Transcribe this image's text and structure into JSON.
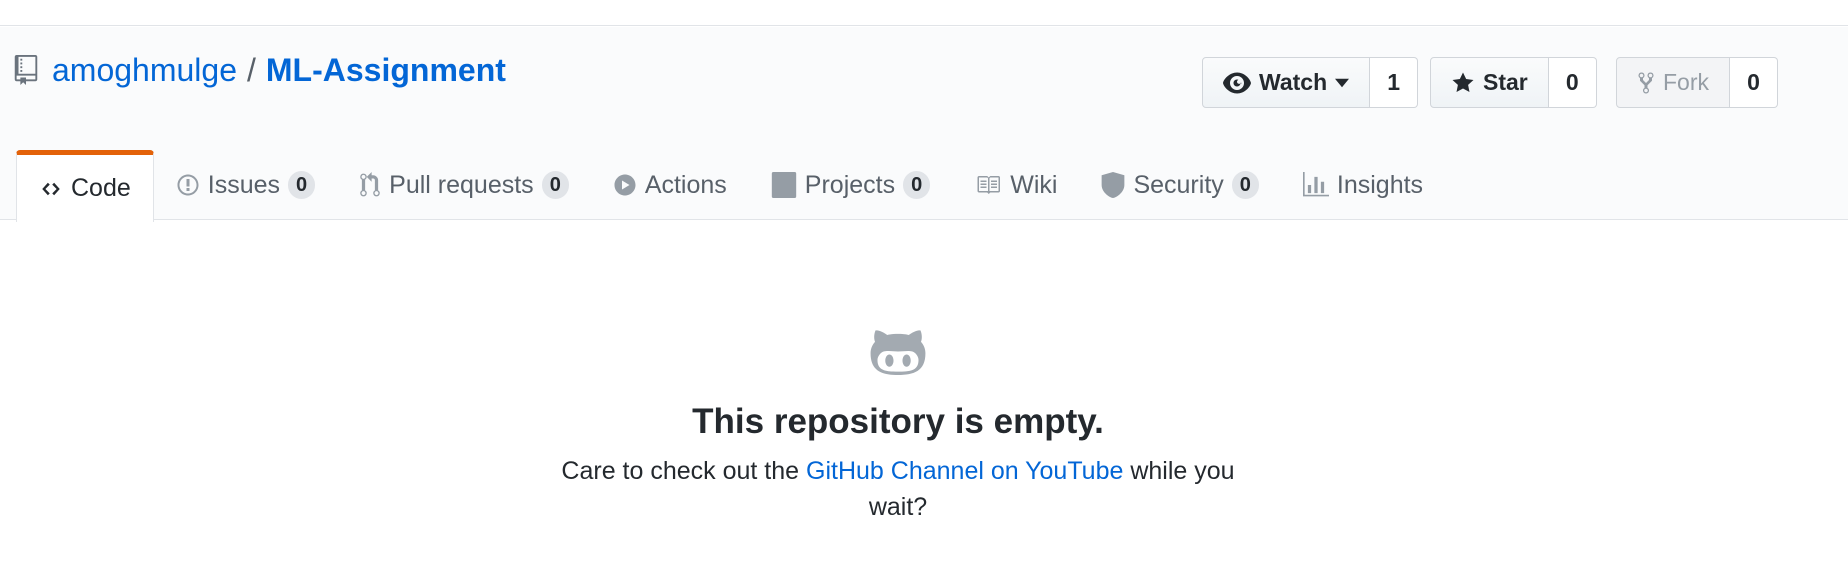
{
  "repo": {
    "owner": "amoghmulge",
    "separator": "/",
    "name": "ML-Assignment"
  },
  "actions": {
    "watch": {
      "label": "Watch",
      "count": "1"
    },
    "star": {
      "label": "Star",
      "count": "0"
    },
    "fork": {
      "label": "Fork",
      "count": "0"
    }
  },
  "tabs": [
    {
      "label": "Code",
      "icon": "code-icon",
      "selected": true
    },
    {
      "label": "Issues",
      "icon": "issue-icon",
      "count": "0"
    },
    {
      "label": "Pull requests",
      "icon": "pull-request-icon",
      "count": "0"
    },
    {
      "label": "Actions",
      "icon": "play-icon"
    },
    {
      "label": "Projects",
      "icon": "project-icon",
      "count": "0"
    },
    {
      "label": "Wiki",
      "icon": "book-icon"
    },
    {
      "label": "Security",
      "icon": "shield-icon",
      "count": "0"
    },
    {
      "label": "Insights",
      "icon": "graph-icon"
    }
  ],
  "blankslate": {
    "title": "This repository is empty.",
    "text_before": "Care to check out the ",
    "link_text": "GitHub Channel on YouTube",
    "text_after": " while you wait?"
  },
  "colors": {
    "link": "#0366d6",
    "selected_tab_accent": "#e36209"
  }
}
